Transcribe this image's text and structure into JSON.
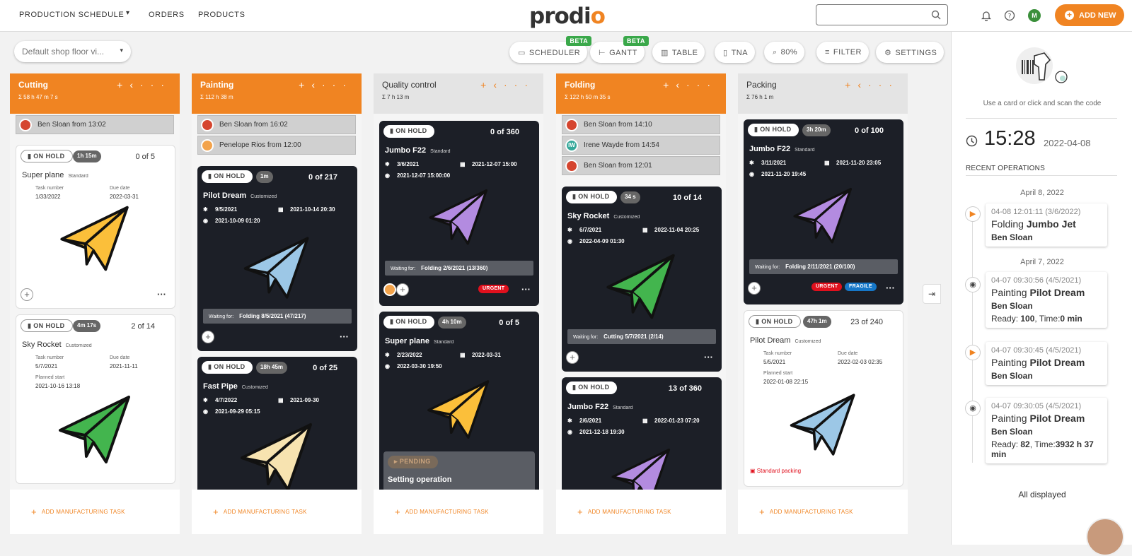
{
  "topbar": {
    "nav": [
      "PRODUCTION SCHEDULE",
      "ORDERS",
      "PRODUCTS"
    ],
    "logo_a": "prod",
    "logo_b": "i",
    "logo_c": "o",
    "add_new": "ADD NEW",
    "user_initial": "M"
  },
  "toolbar": {
    "view": "Default shop floor vi...",
    "buttons": [
      "SCHEDULER",
      "GANTT",
      "TABLE",
      "TNA",
      "80%",
      "FILTER",
      "SETTINGS"
    ],
    "beta": "BETA"
  },
  "footer_label": "ADD MANUFACTURING TASK",
  "columns": [
    {
      "name": "Cutting",
      "sum": "Σ 58 h 47 m 7 s",
      "workers": [
        {
          "name": "Ben Sloan from 13:02"
        }
      ],
      "cards": [
        {
          "badge": "ON HOLD",
          "time": "1h 15m",
          "qty": "0 of 5",
          "title": "Super plane",
          "tag": "Standard",
          "task_lbl": "Task number",
          "task": "1/33/2022",
          "due_lbl": "Due date",
          "due": "2022-03-31",
          "plane": "yellow"
        },
        {
          "badge": "ON HOLD",
          "time": "4m 17s",
          "qty": "2 of 14",
          "title": "Sky Rocket",
          "tag": "Customized",
          "task_lbl": "Task number",
          "task": "5/7/2021",
          "due_lbl": "Due date",
          "due": "2021-11-11",
          "start_lbl": "Planned start",
          "start": "2021-10-16 13:18",
          "plane": "green"
        }
      ]
    },
    {
      "name": "Painting",
      "sum": "Σ 112 h 38 m",
      "workers": [
        {
          "name": "Ben Sloan from 16:02"
        },
        {
          "name": "Penelope Rios from 12:00"
        }
      ],
      "cards": [
        {
          "badge": "ON HOLD",
          "time": "1m",
          "qty": "0 of 217",
          "title": "Pilot Dream",
          "tag": "Customized",
          "task": "9/5/2021",
          "due": "2021-10-14 20:30",
          "start": "2021-10-09 01:20",
          "wait_lbl": "Waiting for:",
          "wait": "Folding 8/5/2021 (47/217)",
          "plane": "blue"
        },
        {
          "badge": "ON HOLD",
          "time": "18h 45m",
          "qty": "0 of 25",
          "title": "Fast Pipe",
          "tag": "Customized",
          "task": "4/7/2022",
          "due": "2021-09-30",
          "start": "2021-09-29 05:15",
          "plane": "cream"
        }
      ]
    },
    {
      "name": "Quality control",
      "sum": "Σ 7 h 13 m",
      "workers": [],
      "cards": [
        {
          "badge": "ON HOLD",
          "qty": "0 of 360",
          "title": "Jumbo F22",
          "tag": "Standard",
          "task": "3/6/2021",
          "due": "2021-12-07 15:00",
          "start": "2021-12-07 15:00:00",
          "wait_lbl": "Waiting for:",
          "wait": "Folding 2/6/2021 (13/360)",
          "label": "URGENT",
          "plane": "purple"
        },
        {
          "badge": "ON HOLD",
          "time": "4h 10m",
          "qty": "0 of 5",
          "title": "Super plane",
          "tag": "Standard",
          "task": "2/23/2022",
          "due": "2022-03-31",
          "start": "2022-03-30 19:50",
          "pending": "PENDING",
          "pending_text": "Setting operation",
          "plane": "yellow"
        }
      ]
    },
    {
      "name": "Folding",
      "sum": "Σ 122 h 50 m 35 s",
      "workers": [
        {
          "name": "Ben Sloan from 14:10"
        },
        {
          "name": "Irene Wayde from 14:54",
          "initials": "IW"
        },
        {
          "name": "Ben Sloan from 12:01"
        }
      ],
      "cards": [
        {
          "badge": "ON HOLD",
          "time": "34 s",
          "qty": "10 of 14",
          "title": "Sky Rocket",
          "tag": "Customized",
          "task": "6/7/2021",
          "due": "2022-11-04 20:25",
          "start": "2022-04-09 01:30",
          "wait_lbl": "Waiting for:",
          "wait": "Cutting 5/7/2021 (2/14)",
          "plane": "green"
        },
        {
          "badge": "ON HOLD",
          "qty": "13 of 360",
          "title": "Jumbo F22",
          "tag": "Standard",
          "task": "2/6/2021",
          "due": "2022-01-23 07:20",
          "start": "2021-12-18 19:30",
          "plane": "purple"
        }
      ]
    },
    {
      "name": "Packing",
      "sum": "Σ 76 h 1 m",
      "workers": [],
      "cards": [
        {
          "badge": "ON HOLD",
          "time": "3h 20m",
          "qty": "0 of 100",
          "title": "Jumbo F22",
          "tag": "Standard",
          "task": "3/11/2021",
          "due": "2021-11-20 23:05",
          "start": "2021-11-20 19:45",
          "wait_lbl": "Waiting for:",
          "wait": "Folding 2/11/2021 (20/100)",
          "label": "URGENT",
          "label2": "FRAGILE",
          "plane": "purple"
        },
        {
          "badge": "ON HOLD",
          "time": "47h 1m",
          "qty": "23 of 240",
          "title": "Pilot Dream",
          "tag": "Customized",
          "task_lbl": "Task number",
          "task": "5/5/2021",
          "due_lbl": "Due date",
          "due": "2022-02-03 02:35",
          "start_lbl": "Planned start",
          "start": "2022-01-08 22:15",
          "packing": "Standard packing",
          "plane": "blue"
        }
      ]
    }
  ],
  "right_panel": {
    "scan": "Use a card or click and scan the code",
    "time": "15:28",
    "date": "2022-04-08",
    "recent": "RECENT OPERATIONS",
    "day1": "April 8, 2022",
    "day2": "April 7, 2022",
    "ops": [
      {
        "time": "04-08 12:01:11 (3/6/2022)",
        "op": "Folding",
        "item": "Jumbo Jet",
        "worker": "Ben Sloan"
      },
      {
        "time": "04-07 09:30:56 (4/5/2021)",
        "op": "Painting",
        "item": "Pilot Dream",
        "worker": "Ben Sloan",
        "ready_lbl": "Ready:",
        "ready": "100",
        "time_lbl": "Time:",
        "dur": "0 min"
      },
      {
        "time": "04-07 09:30:45 (4/5/2021)",
        "op": "Painting",
        "item": "Pilot Dream",
        "worker": "Ben Sloan"
      },
      {
        "time": "04-07 09:30:05 (4/5/2021)",
        "op": "Painting",
        "item": "Pilot Dream",
        "worker": "Ben Sloan",
        "ready_lbl": "Ready:",
        "ready": "82",
        "time_lbl": "Time:",
        "dur": "3932 h 37 min"
      }
    ],
    "all": "All displayed"
  },
  "colors": {
    "accent": "#f08422",
    "card_dark": "#1c1f27",
    "urgent": "#e0101d",
    "fragile": "#1677c8"
  },
  "plane_colors": {
    "yellow": "#fbbf3a",
    "green": "#43b54e",
    "blue": "#9cc7e6",
    "cream": "#f7e3b0",
    "purple": "#b38be0"
  }
}
